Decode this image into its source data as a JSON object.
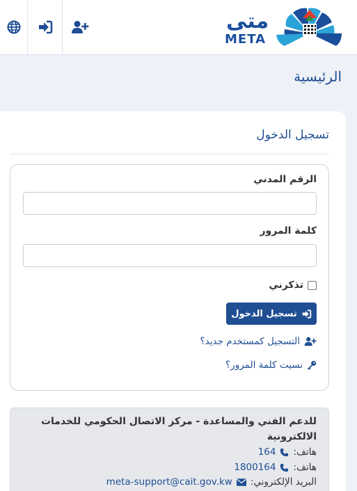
{
  "header": {
    "brand_ar": "متى",
    "brand_en": "META"
  },
  "breadcrumb": {
    "title": "الرئيسية"
  },
  "login": {
    "title": "تسجيل الدخول",
    "civil_id_label": "الرقم المدني",
    "civil_id_value": "",
    "password_label": "كلمة المرور",
    "password_value": "",
    "remember_label": "تذكرني",
    "submit_label": "تسجيل الدخول",
    "register_link": "التسجيل كمستخدم جديد؟",
    "forgot_link": "نسيت كلمة المرور؟"
  },
  "support": {
    "title": "للدعم الفني والمساعدة - مركز الاتصال الحكومي للخدمات الالكترونية",
    "phone_label_1": "هاتف:",
    "phone_value_1": "164",
    "phone_label_2": "هاتف:",
    "phone_value_2": "1800164",
    "email_label": "البريد الإلكتروني:",
    "email_value": "meta-support@cait.gov.kw"
  },
  "colors": {
    "primary": "#1f4e93",
    "background": "#eef1f7"
  }
}
